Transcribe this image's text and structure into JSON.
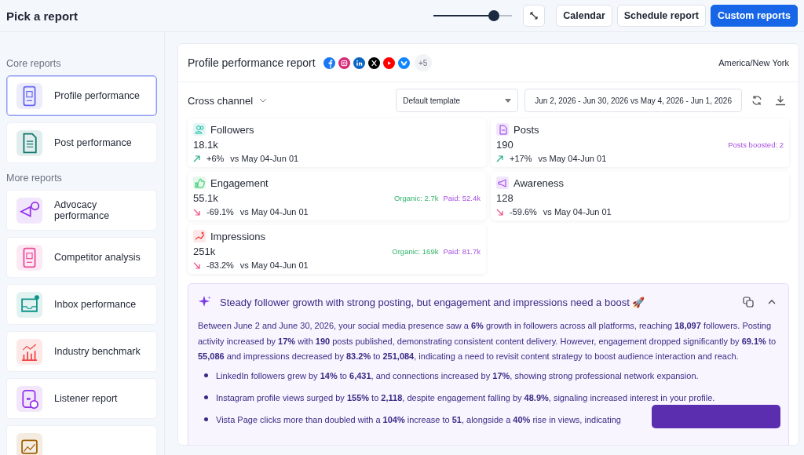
{
  "header": {
    "title": "Pick a report",
    "zoom_slider": {
      "level": 0.77
    },
    "buttons": [
      {
        "label": "Calendar",
        "kind": "plain"
      },
      {
        "label": "Schedule report",
        "kind": "plain"
      },
      {
        "label": "Custom reports",
        "kind": "primary"
      }
    ]
  },
  "sidebar": {
    "sections": [
      {
        "title": "Core reports",
        "items": [
          {
            "label": "Profile performance",
            "selected": true
          },
          {
            "label": "Post performance",
            "selected": false
          }
        ]
      },
      {
        "title": "More reports",
        "items": [
          {
            "label": "Advocacy performance",
            "selected": false
          },
          {
            "label": "Competitor analysis",
            "selected": false
          },
          {
            "label": "Inbox performance",
            "selected": false
          },
          {
            "label": "Industry benchmark",
            "selected": false
          },
          {
            "label": "Listener report",
            "selected": false
          },
          {
            "selected": false
          }
        ]
      }
    ]
  },
  "report": {
    "title": "Profile performance report",
    "more_networks": "+5",
    "timezone": "America/New York",
    "channel": "Cross channel",
    "template": "Default template",
    "date_range": "Jun 2, 2026 - Jun 30, 2026 vs May 4, 2026 - Jun 1, 2026",
    "metrics": [
      {
        "name": "Followers",
        "value": "18.1k",
        "kind": "increase",
        "change": "+6%",
        "period": "vs May 04-Jun 01"
      },
      {
        "name": "Posts",
        "value": "190",
        "kind": "increase",
        "change": "+17%",
        "period": "vs May 04-Jun 01",
        "boosted": "Posts boosted: 2"
      },
      {
        "name": "Engagement",
        "value": "55.1k",
        "kind": "decrease",
        "change": "-69.1%",
        "period": "vs May 04-Jun 01",
        "organic": "Organic: 2.7k",
        "paid": "Paid: 52.4k"
      },
      {
        "name": "Awareness",
        "value": "128",
        "kind": "decrease",
        "change": "-59.6%",
        "period": "vs May 04-Jun 01"
      },
      {
        "name": "Impressions",
        "value": "251k",
        "kind": "decrease",
        "change": "-83.2%",
        "period": "vs May 04-Jun 01",
        "organic": "Organic: 169k",
        "paid": "Paid: 81.7k"
      }
    ],
    "insight": {
      "title": "Steady follower growth with strong posting, but engagement and impressions need a boost 🚀",
      "expanded": true,
      "summary": "Between June 2 and June 30, 2026, your social media presence saw a **6%** growth in followers across all platforms, reaching **18,097** followers. Posting activity increased by **17%** with **190** posts published, demonstrating consistent content delivery. However, engagement dropped significantly by **69.1%** to **55,086** and impressions decreased by **83.2%** to **251,084**, indicating a need to revisit content strategy to boost audience interaction and reach.",
      "bullets": [
        "LinkedIn followers grew by **14%** to **6,431**, and connections increased by **17%**, showing strong professional network expansion.",
        "Instagram profile views surged by **155%** to **2,118**, despite engagement falling by **48.9%**, signaling increased interest in your profile.",
        "Vista Page clicks more than doubled with a **104%** increase to **51**, alongside a **40%** rise in views, indicating"
      ]
    }
  }
}
